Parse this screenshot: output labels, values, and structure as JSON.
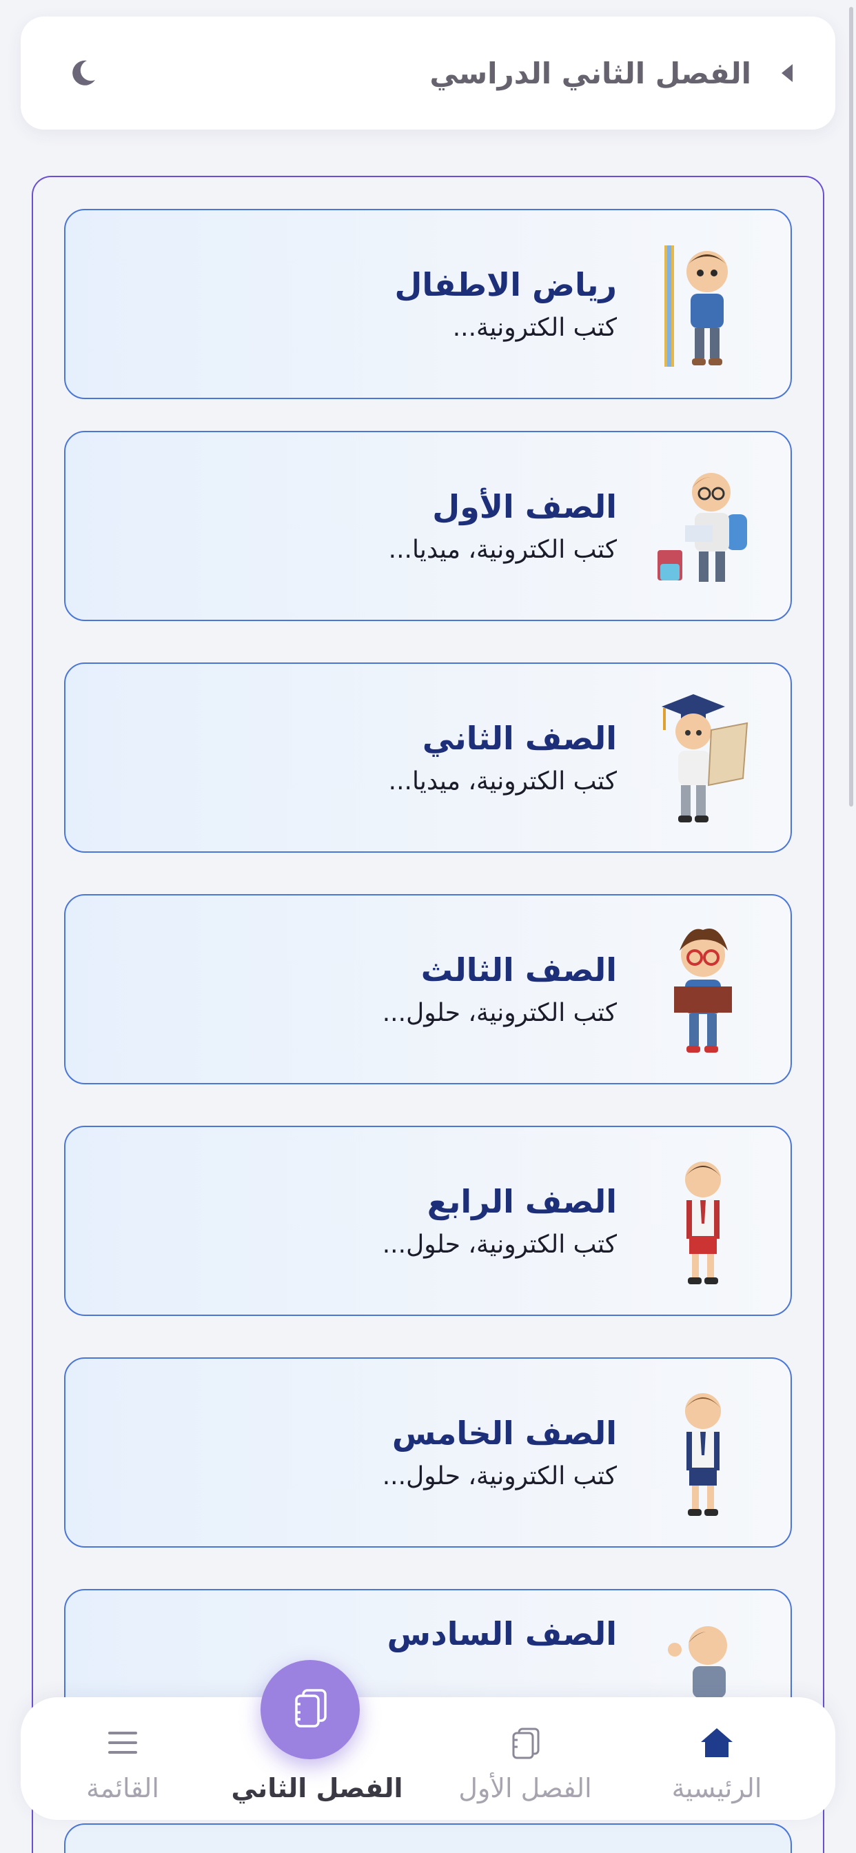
{
  "header": {
    "title": "الفصل الثاني الدراسي",
    "back_icon": "chevron-right-icon",
    "theme_icon": "moon-icon"
  },
  "cards": [
    {
      "title": "رياض الاطفال",
      "subtitle": "كتب الكترونية..."
    },
    {
      "title": "الصف الأول",
      "subtitle": "كتب الكترونية، ميديا..."
    },
    {
      "title": "الصف الثاني",
      "subtitle": "كتب الكترونية، ميديا..."
    },
    {
      "title": "الصف الثالث",
      "subtitle": "كتب الكترونية، حلول..."
    },
    {
      "title": "الصف الرابع",
      "subtitle": "كتب الكترونية، حلول..."
    },
    {
      "title": "الصف الخامس",
      "subtitle": "كتب الكترونية، حلول..."
    },
    {
      "title": "الصف السادس",
      "subtitle": ""
    }
  ],
  "nav": {
    "home": {
      "label": "الرئيسية",
      "icon": "home-icon"
    },
    "term1": {
      "label": "الفصل الأول",
      "icon": "notebook-icon"
    },
    "term2": {
      "label": "الفصل الثاني",
      "icon": "notebook-icon"
    },
    "menu": {
      "label": "القائمة",
      "icon": "menu-icon"
    }
  },
  "colors": {
    "accent": "#9b82e0",
    "card_title": "#1e2f7a",
    "card_border": "#4a76d6",
    "container_border": "#6a4fd6",
    "home_icon": "#1f3c8c"
  }
}
